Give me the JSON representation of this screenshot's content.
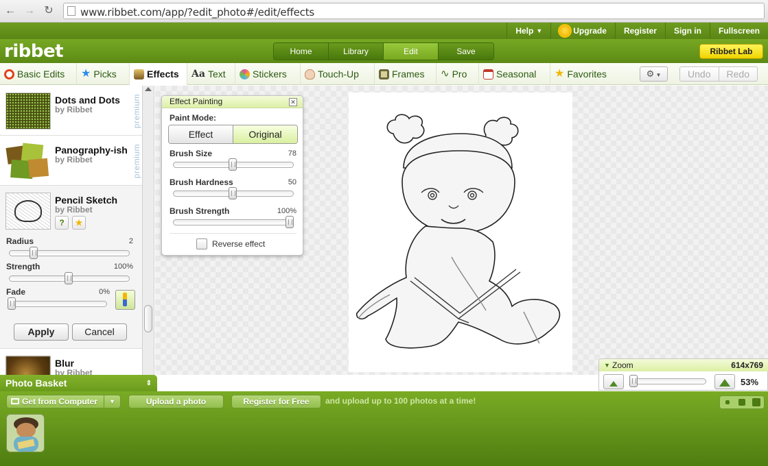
{
  "browser": {
    "url": "www.ribbet.com/app/?edit_photo#/edit/effects"
  },
  "top_links": [
    {
      "label": "Help",
      "name": "help-link"
    },
    {
      "label": "Upgrade",
      "name": "upgrade-link"
    },
    {
      "label": "Register",
      "name": "register-link"
    },
    {
      "label": "Sign in",
      "name": "sign-in-link"
    },
    {
      "label": "Fullscreen",
      "name": "fullscreen-link"
    }
  ],
  "header": {
    "logo": "ribbet",
    "tabs": [
      "Home",
      "Library",
      "Edit",
      "Save"
    ],
    "active_tab": "Edit",
    "lab_button": "Ribbet Lab"
  },
  "tool_tabs": [
    {
      "label": "Basic Edits",
      "icon": "basic-edits-icon",
      "color": "#e0421b"
    },
    {
      "label": "Picks",
      "icon": "star-icon",
      "color": "#2c8ee6"
    },
    {
      "label": "Effects",
      "icon": "effects-icon",
      "color": "#8a6a2a"
    },
    {
      "label": "Text",
      "icon": "text-icon",
      "prefix": "Aa"
    },
    {
      "label": "Stickers",
      "icon": "stickers-icon",
      "color": "#e84fa2"
    },
    {
      "label": "Touch-Up",
      "icon": "touch-up-icon",
      "color": "#c48d62"
    },
    {
      "label": "Frames",
      "icon": "frames-icon",
      "color": "#6a6a3a"
    },
    {
      "label": "Pro",
      "icon": "pro-icon",
      "color": "#3b6b1a"
    },
    {
      "label": "Seasonal",
      "icon": "seasonal-icon",
      "color": "#c0392b"
    },
    {
      "label": "Favorites",
      "icon": "favorites-icon",
      "color": "#f2b705"
    }
  ],
  "toolbar": {
    "undo": "Undo",
    "redo": "Redo"
  },
  "effects": [
    {
      "name": "Dots and Dots",
      "by": "by Ribbet",
      "premium": "premium"
    },
    {
      "name": "Panography-ish",
      "by": "by Ribbet",
      "premium": "premium"
    },
    {
      "name": "Pencil Sketch",
      "by": "by Ribbet"
    },
    {
      "name": "Blur",
      "by": "by Ribbet"
    }
  ],
  "pencil_sketch": {
    "help_button": "?",
    "sliders": [
      {
        "label": "Radius",
        "value": "2",
        "fraction": 0.19
      },
      {
        "label": "Strength",
        "value": "100%",
        "fraction": 0.5
      },
      {
        "label": "Fade",
        "value": "0%",
        "fraction": 0.0
      }
    ],
    "apply": "Apply",
    "cancel": "Cancel"
  },
  "effect_painting": {
    "title": "Effect Painting",
    "paint_mode_label": "Paint Mode:",
    "mode_options": [
      "Effect",
      "Original"
    ],
    "active_mode": "Original",
    "sliders": [
      {
        "label": "Brush Size",
        "value": "78",
        "fraction": 0.5
      },
      {
        "label": "Brush Hardness",
        "value": "50",
        "fraction": 0.5
      },
      {
        "label": "Brush Strength",
        "value": "100%",
        "fraction": 1.0
      }
    ],
    "reverse_label": "Reverse effect"
  },
  "zoom": {
    "label": "Zoom",
    "dimensions": "614x769",
    "percent": "53%",
    "fraction": 0.0
  },
  "basket": {
    "title": "Photo Basket",
    "get_from_computer": "Get from Computer",
    "upload": "Upload a photo",
    "register": "Register for Free",
    "note": "and upload up to 100 photos at a time!"
  },
  "colors": {
    "brand_green": "#6a9a1b",
    "accent_yellow": "#f0d400"
  }
}
